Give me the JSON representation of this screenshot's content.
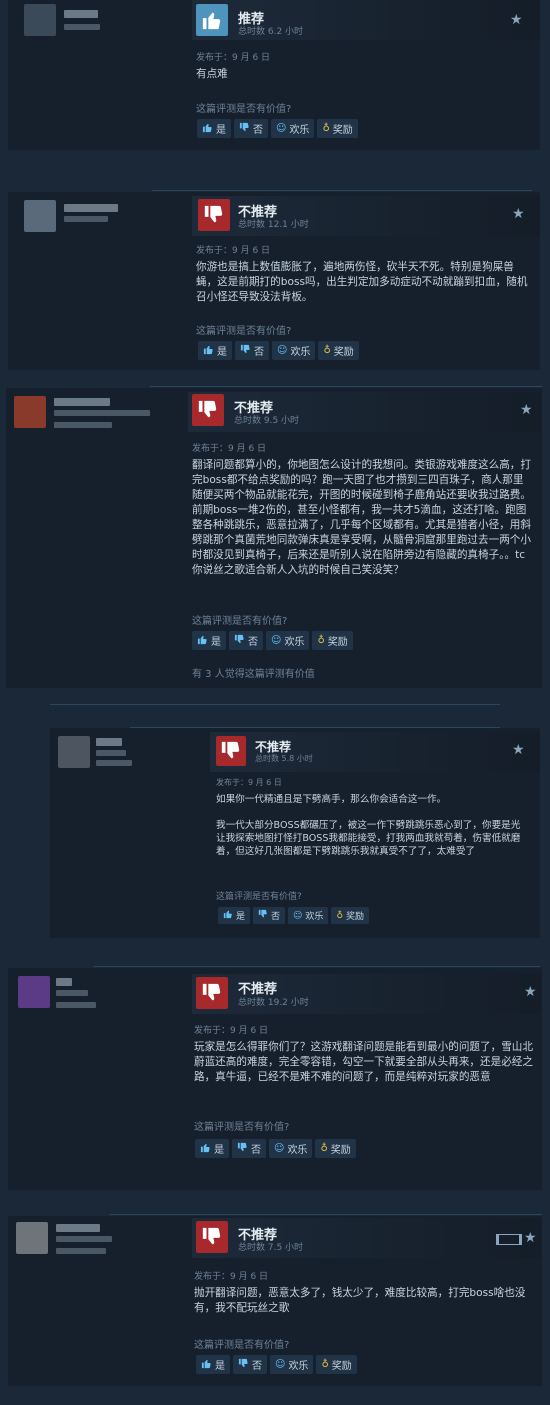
{
  "labels": {
    "question": "这篇评测是否有价值?",
    "yes": "是",
    "no": "否",
    "funny": "欢乐",
    "award": "奖励"
  },
  "icons": {
    "thumb_up": "thumbs-up-icon",
    "thumb_down": "thumbs-down-icon",
    "star": "star-icon",
    "film": "video-icon",
    "smile": "smile-icon",
    "award": "award-icon"
  },
  "colors": {
    "recommended": "#4f94bc",
    "not_recommended": "#a7292c",
    "background": "#1b2838"
  },
  "reviews": [
    {
      "verdict": "推荐",
      "hours": "总时数 6.2 小时",
      "date": "发布于：9 月 6 日",
      "body": [
        "有点难"
      ]
    },
    {
      "verdict": "不推荐",
      "hours": "总时数 12.1 小时",
      "date": "发布于：9 月 6 日",
      "body": [
        "你游也是搞上数值膨胀了，遍地两伤怪，砍半天不死。特别是狗屎兽蝇，这是前期打的boss吗，出生判定加多动症动不动就蹦到扣血，随机召小怪还导致没法背板。"
      ]
    },
    {
      "verdict": "不推荐",
      "hours": "总时数 9.5 小时",
      "date": "发布于：9 月 6 日",
      "body": [
        "翻译问题都算小的，你地图怎么设计的我想问。类银游戏难度这么高，打完boss都不给点奖励的吗？跑一天图了也才攒到三四百珠子，商人那里随便买两个物品就能花完，开图的时候碰到椅子鹿角站还要收我过路费。前期boss一堆2伤的，甚至小怪都有，我一共才5滴血，这还打啥。跑图整各种跳跳乐，恶意拉满了，几乎每个区域都有。尤其是猎者小径，用斜劈跳那个真菌荒地同款弹床真是享受啊，从髓骨洞窟那里跑过去一两个小时都没见到真椅子，后来还是听别人说在陷阱旁边有隐藏的真椅子。。tc你说丝之歌适合新人入坑的时候自己笑没笑？"
      ],
      "helpful": "有 3 人觉得这篇评测有价值"
    },
    {
      "verdict": "不推荐",
      "hours": "总时数 5.8 小时",
      "date": "发布于：9 月 6 日",
      "body": [
        "如果你一代精通且是下劈高手，那么你会适合这一作。",
        "我一代大部分BOSS都碾压了，被这一作下劈跳跳乐恶心到了，你要是光让我探索地图打怪打BOSS我都能接受，打我两血我就苟着，伤害低就磨着，但这好几张图都是下劈跳跳乐我就真受不了了，太难受了"
      ]
    },
    {
      "verdict": "不推荐",
      "hours": "总时数 19.2 小时",
      "date": "发布于：9 月 6 日",
      "body": [
        "玩家是怎么得罪你们了？这游戏翻译问题是能看到最小的问题了，雪山北蔚蓝还高的难度，完全零容错，勾空一下就要全部从头再来，还是必经之路，真牛逼，已经不是难不难的问题了，而是纯粹对玩家的恶意"
      ]
    },
    {
      "verdict": "不推荐",
      "hours": "总时数 7.5 小时",
      "date": "发布于：9 月 6 日",
      "body": [
        "抛开翻译问题，恶意太多了，钱太少了，难度比较高，打完boss啥也没有，我不配玩丝之歌"
      ]
    }
  ]
}
